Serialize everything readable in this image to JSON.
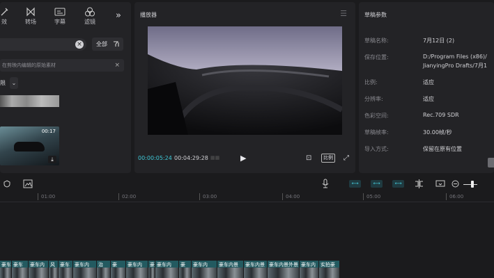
{
  "left_panel": {
    "tabs": [
      {
        "icon": "effects-icon",
        "label": "效"
      },
      {
        "icon": "transition-icon",
        "label": "转场"
      },
      {
        "icon": "subtitle-icon",
        "label": "字幕"
      },
      {
        "icon": "filter-icon",
        "label": "滤镜"
      }
    ],
    "more_glyph": "»",
    "search": {
      "value": "",
      "clear_glyph": "×"
    },
    "filter_label": "全部",
    "tip_text": "在剪映内编辑的原始素材",
    "tip_close": "×",
    "select_label": "限",
    "select_chevron": "⌄",
    "clip_duration": "00:17"
  },
  "player": {
    "title": "播放器",
    "current_time": "00:00:05:24",
    "total_time": "00:04:29:28",
    "ratio_label": "比例"
  },
  "props": {
    "title": "草稿参数",
    "rows": [
      {
        "label": "草稿名称:",
        "value": "7月12日 (2)"
      },
      {
        "label": "保存位置:",
        "value": "D:/Program Files (x86)/",
        "value2": "JianyingPro Drafts/7月1"
      },
      {
        "label": "比例:",
        "value": "适应"
      },
      {
        "label": "分辨率:",
        "value": "适应"
      },
      {
        "label": "色彩空间:",
        "value": "Rec.709 SDR"
      },
      {
        "label": "草稿帧率:",
        "value": "30.00帧/秒"
      },
      {
        "label": "导入方式:",
        "value": "保留在原有位置"
      }
    ]
  },
  "timeline": {
    "ruler": [
      "01:00",
      "02:00",
      "03:00",
      "04:00",
      "05:00",
      "06:00"
    ],
    "clips": [
      "豪车",
      "豪车",
      "豪车内",
      "风",
      "豪车",
      "豪车内",
      "治",
      "豪",
      "豪车内",
      "豪",
      "豪车内",
      "豪",
      "豪车内",
      "豪车内景",
      "豪车内景",
      "豪车内景外景",
      "豪车内",
      "实拍豪"
    ]
  },
  "colors": {
    "accent": "#3ec9d8",
    "clip": "#235a60",
    "panel": "#232326",
    "bg": "#1b1b1d"
  }
}
